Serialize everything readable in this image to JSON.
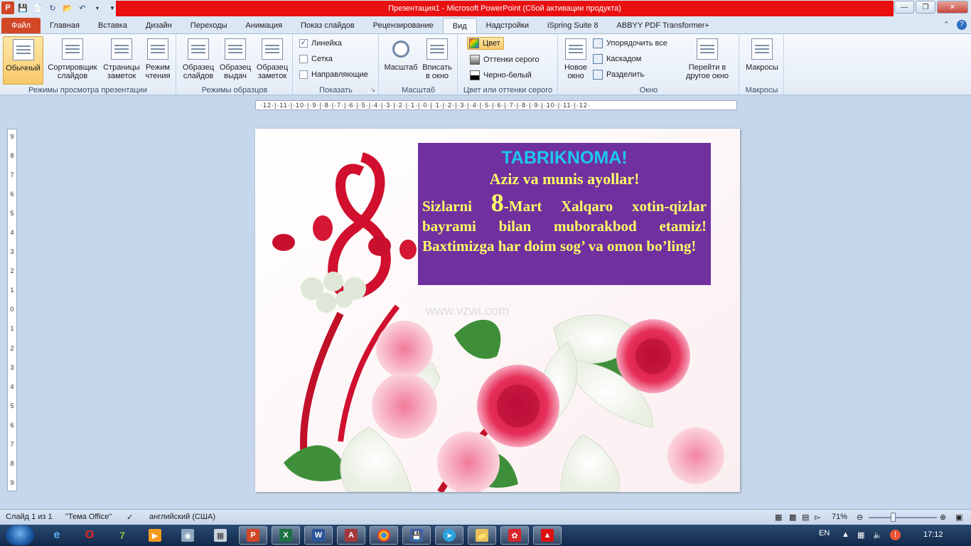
{
  "window": {
    "title": "Презентация1  -  Microsoft PowerPoint (Сбой активации продукта)"
  },
  "tabs": [
    {
      "label": "Файл"
    },
    {
      "label": "Главная"
    },
    {
      "label": "Вставка"
    },
    {
      "label": "Дизайн"
    },
    {
      "label": "Переходы"
    },
    {
      "label": "Анимация"
    },
    {
      "label": "Показ слайдов"
    },
    {
      "label": "Рецензирование"
    },
    {
      "label": "Вид"
    },
    {
      "label": "Надстройки"
    },
    {
      "label": "iSpring Suite 8"
    },
    {
      "label": "ABBYY PDF Transformer+"
    }
  ],
  "active_tab": "Вид",
  "ribbon": {
    "views": {
      "group_label": "Режимы просмотра презентации",
      "normal": "Обычный",
      "sorter": "Сортировщик слайдов",
      "notes": "Страницы заметок",
      "reading": "Режим чтения"
    },
    "masters": {
      "group_label": "Режимы образцов",
      "slide_master": "Образец слайдов",
      "handout_master": "Образец выдач",
      "notes_master": "Образец заметок"
    },
    "show": {
      "group_label": "Показать",
      "ruler": "Линейка",
      "ruler_checked": true,
      "grid": "Сетка",
      "grid_checked": false,
      "guides": "Направляющие",
      "guides_checked": false
    },
    "zoom": {
      "group_label": "Масштаб",
      "zoom": "Масштаб",
      "fit": "Вписать в окно"
    },
    "color": {
      "group_label": "Цвет или оттенки серого",
      "color": "Цвет",
      "grayscale": "Оттенки серого",
      "bw": "Черно-белый"
    },
    "window": {
      "group_label": "Окно",
      "new_window": "Новое окно",
      "arrange_all": "Упорядочить все",
      "cascade": "Каскадом",
      "split": "Разделить",
      "switch": "Перейти в другое окно"
    },
    "macros": {
      "group_label": "Макросы",
      "macros": "Макросы"
    }
  },
  "ruler": {
    "h_ticks": "·12·|·11·|·10·|·9·|·8·|·7·|·6·|·5·|·4·|·3·|·2·|·1·|·0·|·1·|·2·|·3·|·4·|·5·|·6·|·7·|·8·|·9·|·10·|·11·|·12·",
    "v_ticks": [
      "9",
      "8",
      "7",
      "6",
      "5",
      "4",
      "3",
      "2",
      "1",
      "0",
      "1",
      "2",
      "3",
      "4",
      "5",
      "6",
      "7",
      "8",
      "9"
    ]
  },
  "slide": {
    "title": "TABRIKNOMA!",
    "subtitle": "Aziz va munis ayollar!",
    "body_before": "Sizlarni ",
    "body_big": "8",
    "body_after": "-Mart Xalqaro xotin-qizlar bayrami bilan muborakbod etamiz! Baxtimizga har doim sog’ va omon bo’ling!",
    "watermark": "www.vzwi.com",
    "colors": {
      "box": "#7030a0",
      "title": "#1dc8f0",
      "text": "#ffff66"
    }
  },
  "status": {
    "slide": "Слайд 1 из 1",
    "theme": "\"Тема Office\"",
    "language": "английский (США)",
    "zoom": "71%"
  },
  "taskbar": {
    "language": "EN",
    "clock": "17:12"
  }
}
